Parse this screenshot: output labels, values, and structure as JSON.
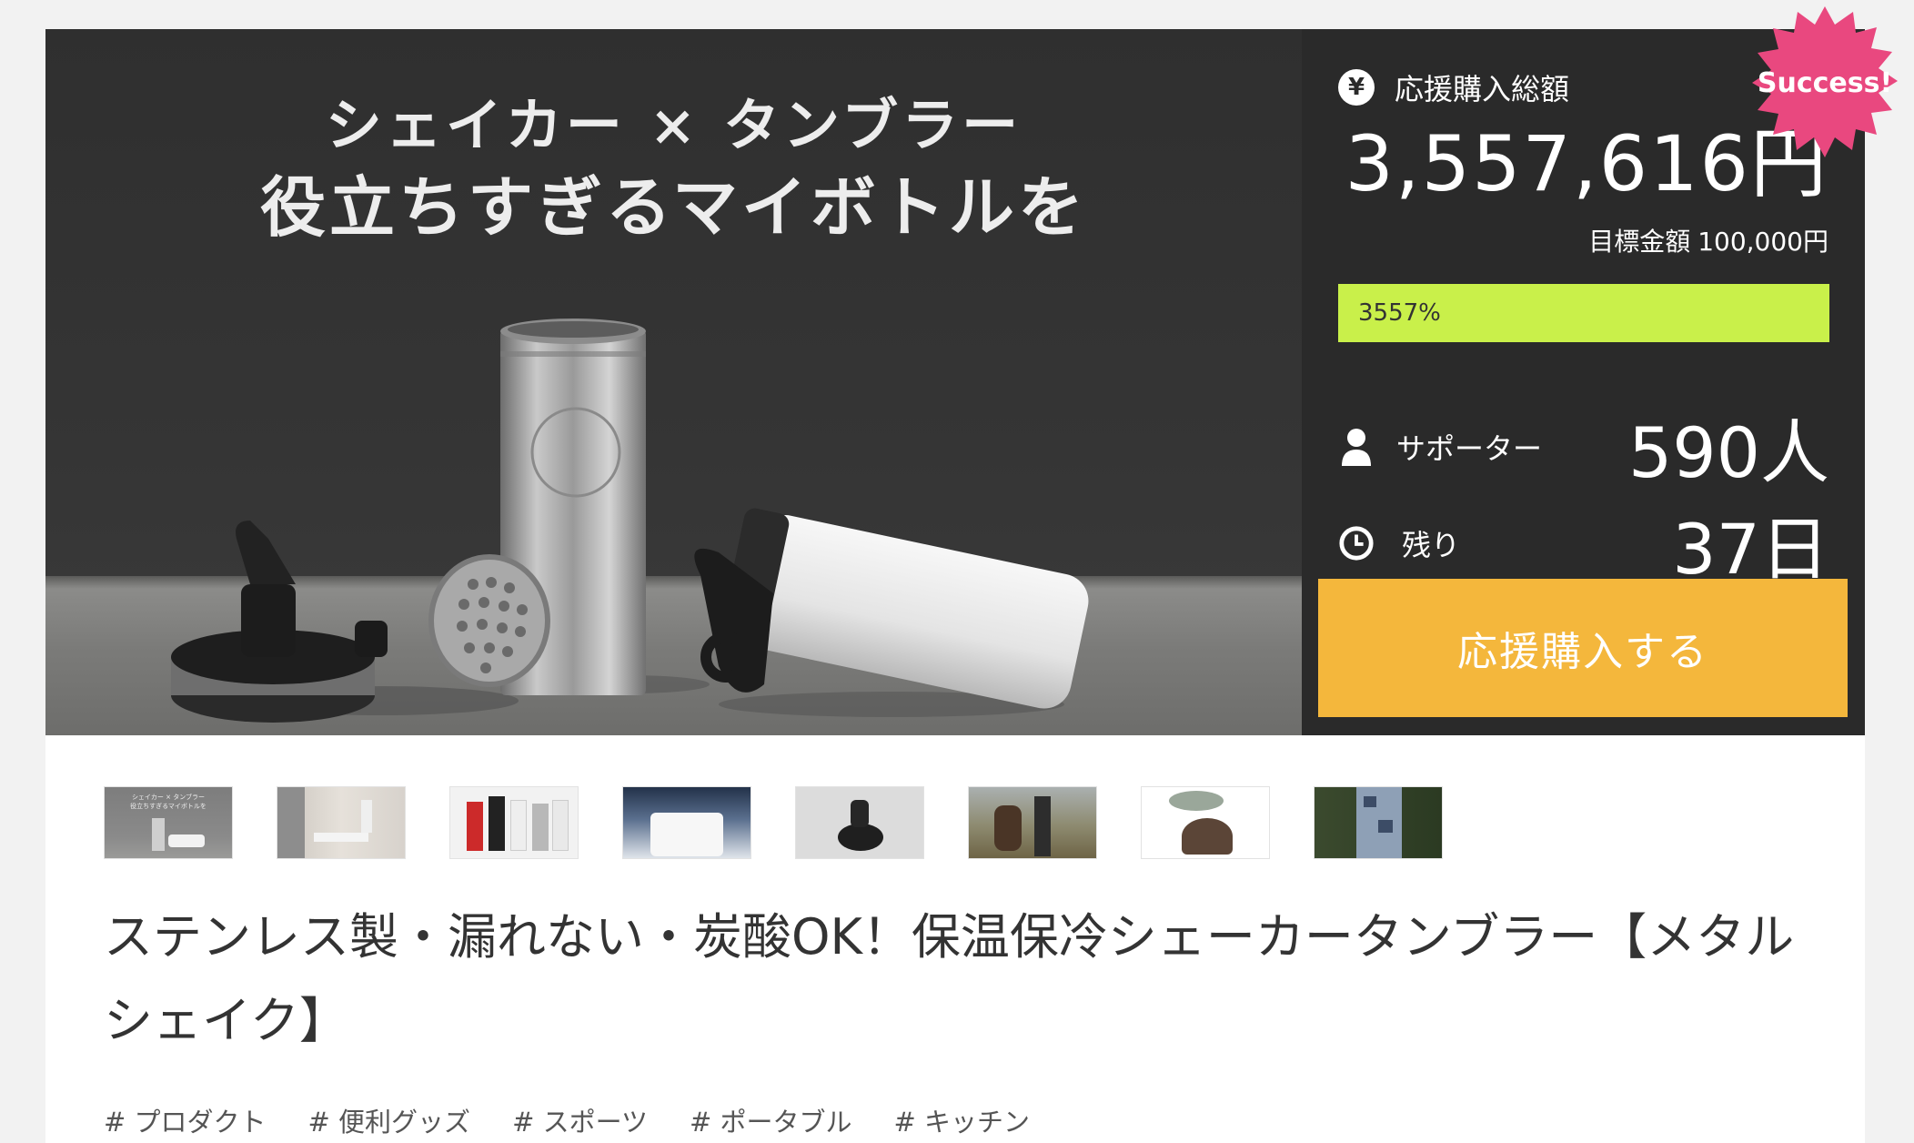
{
  "hero": {
    "line1": "シェイカー × タンブラー",
    "line2": "役立ちすぎるマイボトルを"
  },
  "stats": {
    "total_label": "応援購入総額",
    "total_amount": "3,557,616円",
    "goal_label": "目標金額",
    "goal_value": "100,000円",
    "progress_text": "3557%",
    "progress_fraction": 1.0,
    "supporters_label": "サポーター",
    "supporters_value": "590人",
    "remaining_label": "残り",
    "remaining_value": "37日",
    "cta_label": "応援購入する",
    "badge": "Success!"
  },
  "colors": {
    "panel_bg": "#2a2a2a",
    "progress": "#c9f04a",
    "cta": "#f4b73c",
    "badge": "#e9487f"
  },
  "thumbnail_caption": {
    "line1": "シェイカー × タンブラー",
    "line2": "役立ちすぎるマイボトルを"
  },
  "title": "ステンレス製・漏れない・炭酸OK！保温保冷シェーカータンブラー【メタルシェイク】",
  "tags": [
    "# プロダクト",
    "# 便利グッズ",
    "# スポーツ",
    "# ポータブル",
    "# キッチン"
  ]
}
